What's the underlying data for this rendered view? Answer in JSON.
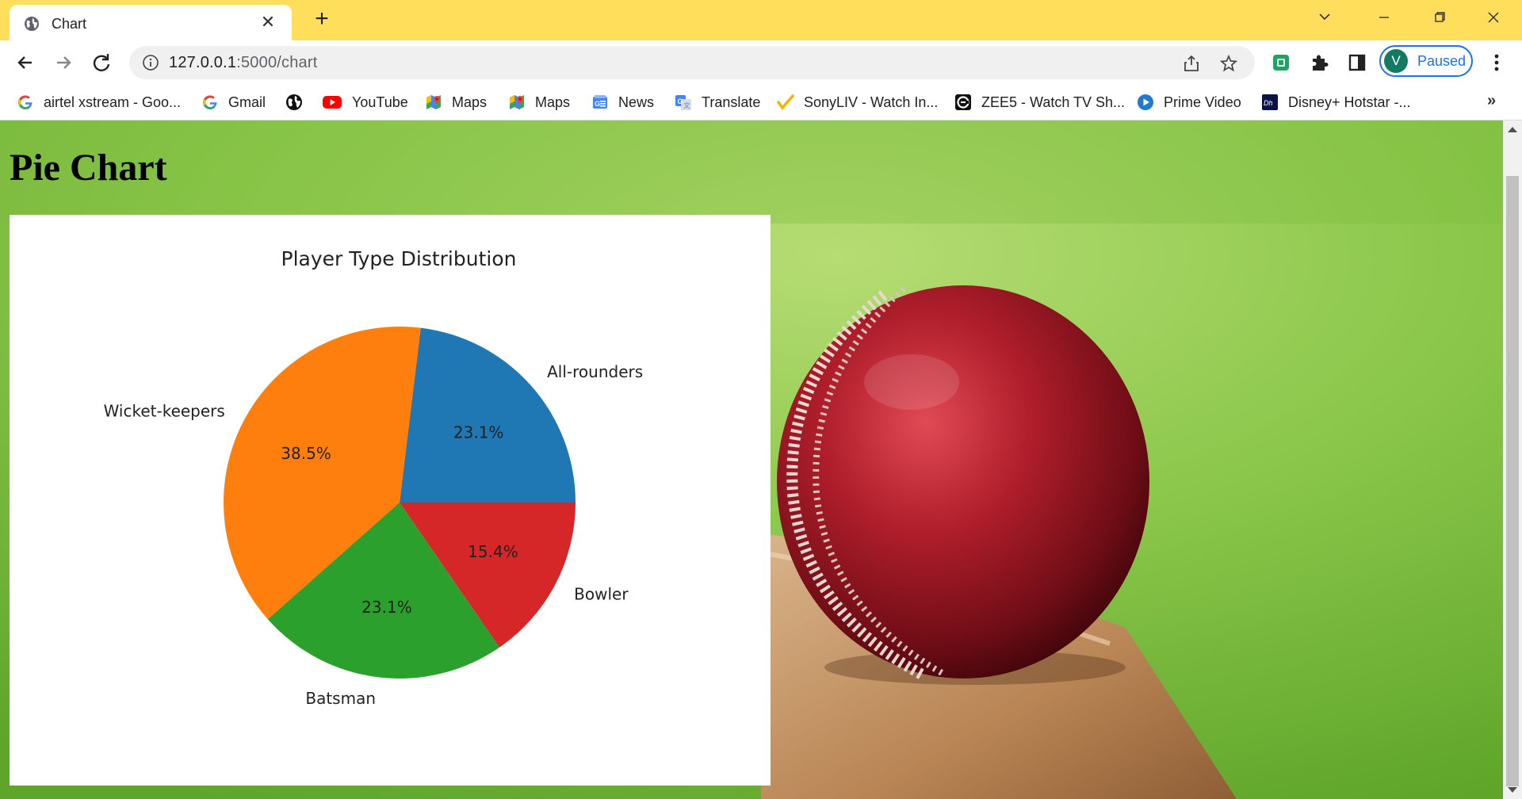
{
  "browser": {
    "tab": {
      "title": "Chart",
      "favicon": "globe-icon"
    },
    "address_bar": {
      "host": "127.0.0.1",
      "path": ":5000/chart"
    },
    "profile": {
      "initial": "V",
      "status": "Paused",
      "avatar_color": "#137a63"
    },
    "bookmarks": [
      {
        "label": "airtel xstream - Goo...",
        "icon": "google-icon"
      },
      {
        "label": "Gmail",
        "icon": "google-icon"
      },
      {
        "label": "",
        "icon": "globe-icon"
      },
      {
        "label": "YouTube",
        "icon": "youtube-icon"
      },
      {
        "label": "Maps",
        "icon": "maps-icon"
      },
      {
        "label": "Maps",
        "icon": "maps-icon"
      },
      {
        "label": "News",
        "icon": "news-icon"
      },
      {
        "label": "Translate",
        "icon": "translate-icon"
      },
      {
        "label": "SonyLIV - Watch In...",
        "icon": "sonyliv-icon"
      },
      {
        "label": "ZEE5 - Watch TV Sh...",
        "icon": "zee5-icon"
      },
      {
        "label": "Prime Video",
        "icon": "prime-video-icon"
      },
      {
        "label": "Disney+ Hotstar -...",
        "icon": "hotstar-icon"
      }
    ],
    "colors": {
      "tabstrip": "#ffde5c",
      "accent": "#1a73e8"
    }
  },
  "page": {
    "heading": "Pie Chart"
  },
  "chart_data": {
    "type": "pie",
    "title": "Player Type Distribution",
    "categories": [
      "All-rounders",
      "Wicket-keepers",
      "Batsman",
      "Bowler"
    ],
    "values": [
      23.1,
      38.5,
      23.1,
      15.4
    ],
    "value_labels": [
      "23.1%",
      "38.5%",
      "23.1%",
      "15.4%"
    ],
    "colors": [
      "#1f77b4",
      "#ff7f0e",
      "#2ca02c",
      "#d62728"
    ],
    "start_angle_deg": 0,
    "direction": "counterclockwise"
  }
}
